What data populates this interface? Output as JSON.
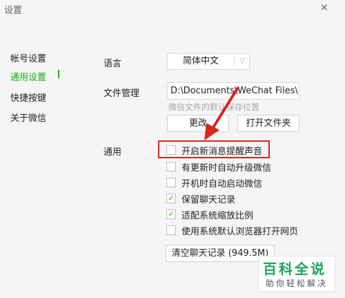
{
  "window": {
    "title": "设置",
    "close_symbol": "×"
  },
  "sidebar": {
    "items": [
      {
        "label": "帐号设置",
        "active": false
      },
      {
        "label": "通用设置",
        "active": true
      },
      {
        "label": "快捷按键",
        "active": false
      },
      {
        "label": "关于微信",
        "active": false
      }
    ],
    "active_color": "#1aad19"
  },
  "language": {
    "label": "语言",
    "value": "简体中文"
  },
  "file_management": {
    "label": "文件管理",
    "path": "D:\\Documents\\WeChat Files\\",
    "hint": "微信文件的默认保存位置",
    "change_button": "更改",
    "open_folder_button": "打开文件夹"
  },
  "general": {
    "label": "通用",
    "options": [
      {
        "label": "开启新消息提醒声音",
        "checked": false
      },
      {
        "label": "有更新时自动升级微信",
        "checked": false
      },
      {
        "label": "开机时自动启动微信",
        "checked": false
      },
      {
        "label": "保留聊天记录",
        "checked": true
      },
      {
        "label": "适配系统缩放比例",
        "checked": true
      },
      {
        "label": "使用系统默认浏览器打开网页",
        "checked": false
      }
    ],
    "clear_button": "清空聊天记录 (949.5M)"
  },
  "annotation": {
    "color": "#d6261d"
  },
  "watermark": {
    "title": "百科全说",
    "subtitle": "助你轻松解决",
    "color": "#1fa25a"
  }
}
